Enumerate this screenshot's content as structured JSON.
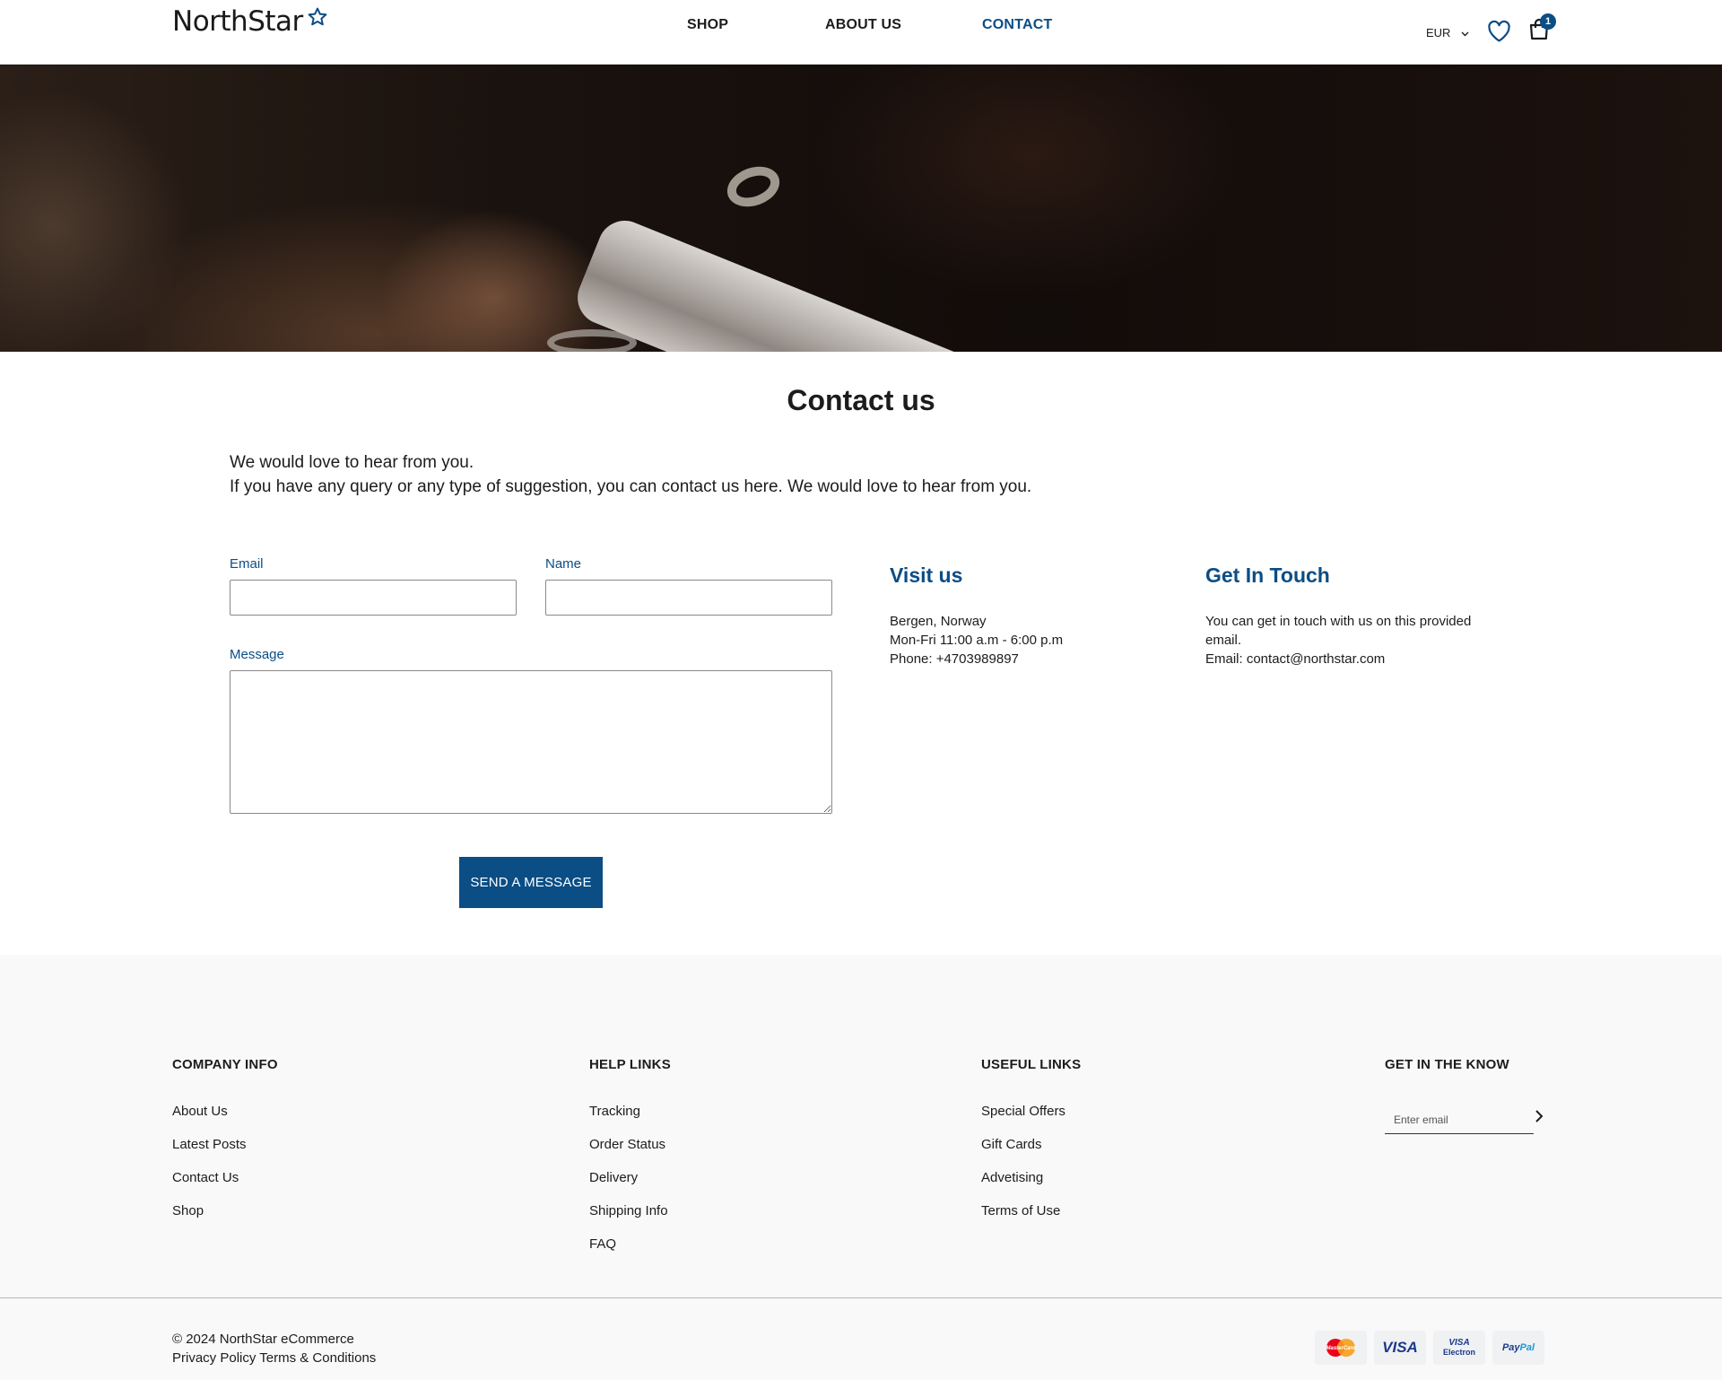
{
  "brand": {
    "name": "NorthStar",
    "accent": "#0b4d85"
  },
  "nav": {
    "shop": "SHOP",
    "about": "ABOUT US",
    "contact": "CONTACT",
    "active": "contact"
  },
  "header": {
    "currency": "EUR",
    "cart_count": "1",
    "icons": [
      "star-icon",
      "chevron-down-icon",
      "heart-icon",
      "bag-icon"
    ]
  },
  "contact": {
    "title": "Contact us",
    "intro_line1": "We would love to hear from you.",
    "intro_line2": "If you have any query or any type of suggestion, you can contact us here. We would love to hear from you.",
    "form": {
      "email_label": "Email",
      "email_value": "",
      "name_label": "Name",
      "name_value": "",
      "message_label": "Message",
      "message_value": "",
      "submit_label": "SEND A MESSAGE"
    },
    "visit": {
      "heading": "Visit us",
      "address": "Bergen, Norway",
      "hours": "Mon-Fri 11:00 a.m - 6:00 p.m",
      "phone": "Phone: +4703989897"
    },
    "touch": {
      "heading": "Get In Touch",
      "text": "You can get in touch with us on this provided email.",
      "email": "Email: contact@northstar.com"
    }
  },
  "footer": {
    "company": {
      "heading": "COMPANY INFO",
      "links": [
        "About Us",
        "Latest Posts",
        "Contact Us",
        "Shop"
      ]
    },
    "help": {
      "heading": "HELP LINKS",
      "links": [
        "Tracking",
        "Order Status",
        "Delivery",
        "Shipping Info",
        "FAQ"
      ]
    },
    "useful": {
      "heading": "USEFUL LINKS",
      "links": [
        "Special Offers",
        "Gift Cards",
        "Advetising",
        "Terms of Use"
      ]
    },
    "newsletter": {
      "heading": "GET IN THE KNOW",
      "placeholder": "Enter email"
    },
    "copyright": "© 2024 NorthStar eCommerce",
    "legal": "Privacy Policy Terms & Conditions",
    "payments": {
      "mastercard": "MasterCard",
      "visa": "VISA",
      "visa_electron_top": "VISA",
      "visa_electron_bottom": "Electron",
      "paypal_a": "Pay",
      "paypal_b": "Pal"
    }
  }
}
